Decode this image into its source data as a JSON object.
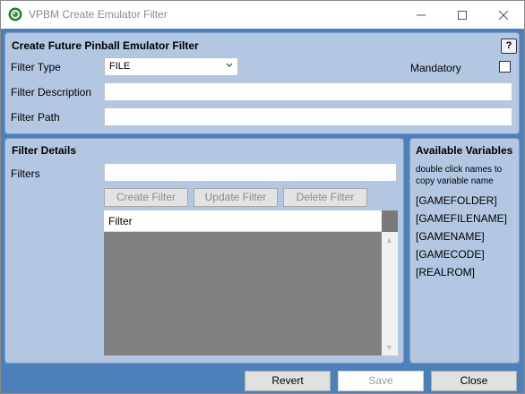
{
  "window": {
    "title": "VPBM Create Emulator Filter"
  },
  "top_panel": {
    "title": "Create Future Pinball Emulator Filter",
    "help_label": "?",
    "filter_type_label": "Filter Type",
    "filter_type_value": "FILE",
    "mandatory_label": "Mandatory",
    "filter_description_label": "Filter Description",
    "filter_description_value": "",
    "filter_path_label": "Filter Path",
    "filter_path_value": ""
  },
  "details": {
    "title": "Filter Details",
    "filters_label": "Filters",
    "filters_value": "",
    "create_label": "Create Filter",
    "update_label": "Update Filter",
    "delete_label": "Delete Filter",
    "list_header": "Filter"
  },
  "variables": {
    "title": "Available Variables",
    "description": "double click names to copy variable name",
    "items": [
      "[GAMEFOLDER]",
      "[GAMEFILENAME]",
      "[GAMENAME]",
      "[GAMECODE]",
      "[REALROM]"
    ]
  },
  "buttons": {
    "revert": "Revert",
    "save": "Save",
    "close": "Close"
  },
  "colors": {
    "background": "#4d7fb8",
    "panel": "#b3c7e3",
    "list_empty": "#808080"
  },
  "icons": {
    "app": "pinball-app-icon",
    "minimize": "minimize-icon",
    "maximize": "maximize-icon",
    "close": "close-icon",
    "dropdown": "chevron-down-icon"
  }
}
